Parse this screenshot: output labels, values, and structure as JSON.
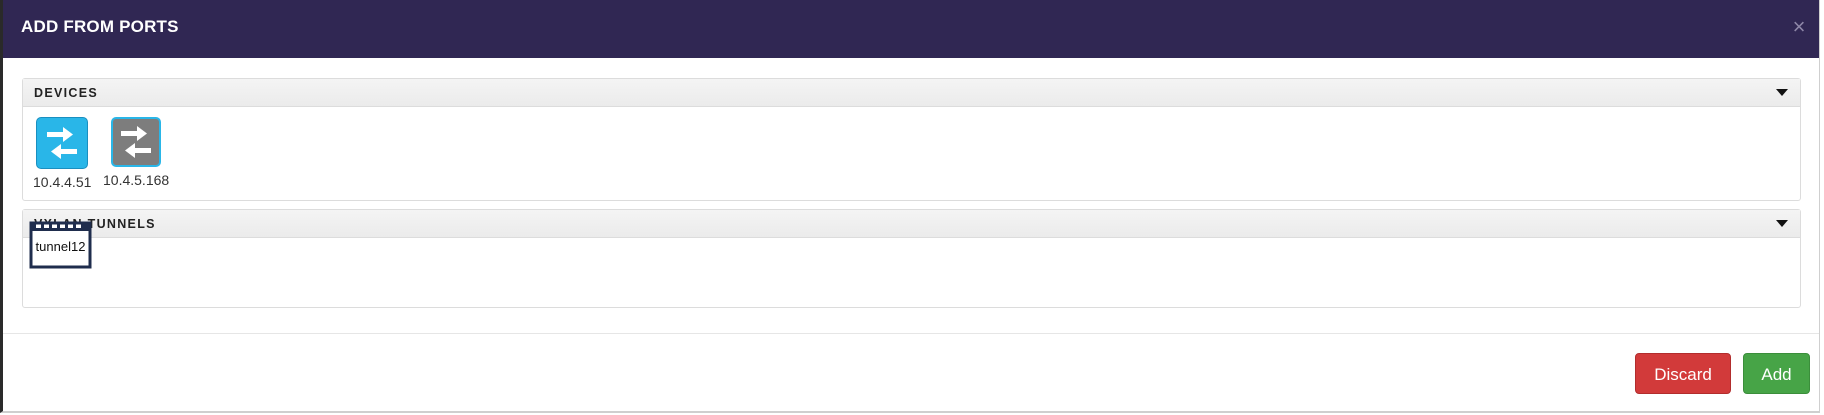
{
  "modal": {
    "title": "ADD FROM PORTS",
    "close_symbol": "×"
  },
  "devices_panel": {
    "title": "DEVICES",
    "items": [
      {
        "label": "10.4.4.51",
        "icon": "network-switch-icon",
        "color": "#29b6e8",
        "state": "selected"
      },
      {
        "label": "10.4.5.168",
        "icon": "network-switch-icon",
        "color": "#7d7d7d",
        "state": "inactive"
      }
    ]
  },
  "tunnels_panel": {
    "title": "VXLAN TUNNELS",
    "items": [
      {
        "label": "tunnel12",
        "icon": "tunnel-icon",
        "color": "#1f2d4d"
      }
    ]
  },
  "footer": {
    "discard_label": "Discard",
    "add_label": "Add"
  },
  "colors": {
    "header": "#302753",
    "discard": "#d23a3a",
    "add": "#47a447"
  }
}
